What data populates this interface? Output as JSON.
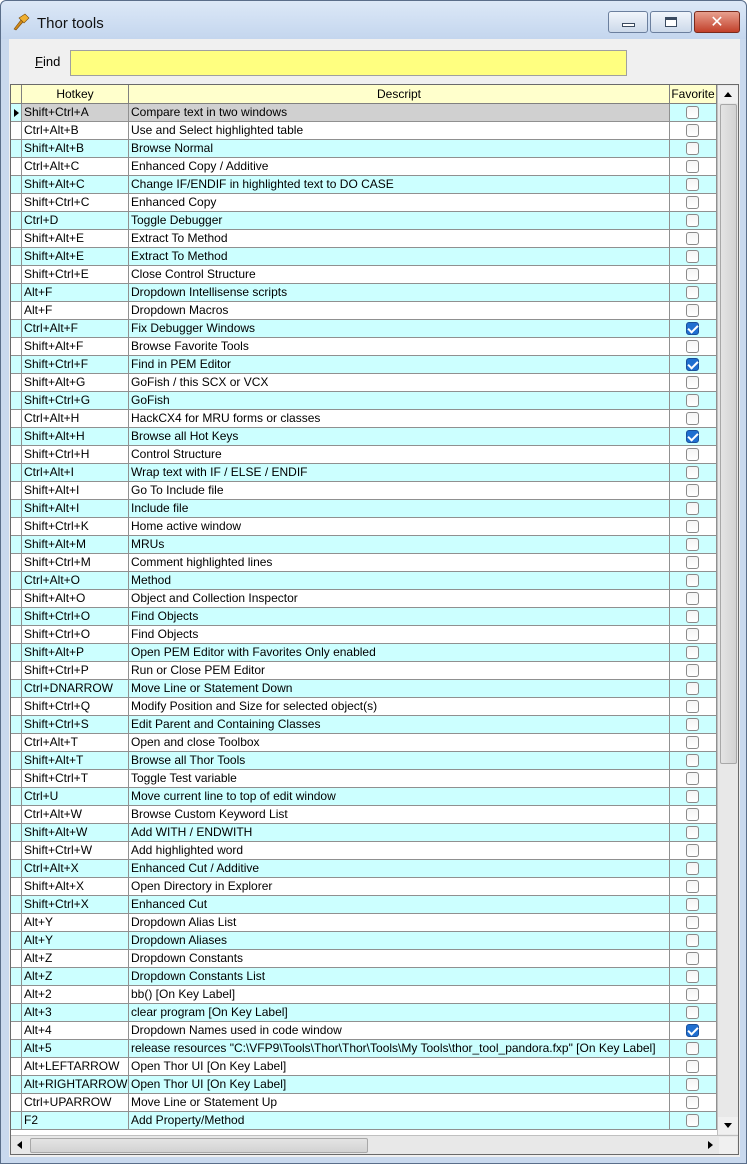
{
  "window": {
    "title": "Thor tools",
    "close_glyph": "✕"
  },
  "find": {
    "label": "Find",
    "label_accel": "F",
    "label_rest": "ind",
    "value": ""
  },
  "grid": {
    "columns": {
      "hotkey": "Hotkey",
      "descript": "Descript",
      "favorite": "Favorite"
    },
    "rows": [
      {
        "hotkey": "Shift+Ctrl+A",
        "descript": "Compare text in two windows",
        "favorite": false
      },
      {
        "hotkey": "Ctrl+Alt+B",
        "descript": "Use and Select highlighted table",
        "favorite": false
      },
      {
        "hotkey": "Shift+Alt+B",
        "descript": "Browse Normal",
        "favorite": false
      },
      {
        "hotkey": "Ctrl+Alt+C",
        "descript": "Enhanced Copy / Additive",
        "favorite": false
      },
      {
        "hotkey": "Shift+Alt+C",
        "descript": "Change IF/ENDIF in highlighted text to DO CASE",
        "favorite": false
      },
      {
        "hotkey": "Shift+Ctrl+C",
        "descript": "Enhanced Copy",
        "favorite": false
      },
      {
        "hotkey": "Ctrl+D",
        "descript": "Toggle Debugger",
        "favorite": false
      },
      {
        "hotkey": "Shift+Alt+E",
        "descript": "Extract To Method",
        "favorite": false
      },
      {
        "hotkey": "Shift+Alt+E",
        "descript": "Extract To Method",
        "favorite": false
      },
      {
        "hotkey": "Shift+Ctrl+E",
        "descript": "Close Control Structure",
        "favorite": false
      },
      {
        "hotkey": "Alt+F",
        "descript": "Dropdown Intellisense scripts",
        "favorite": false
      },
      {
        "hotkey": "Alt+F",
        "descript": "Dropdown Macros",
        "favorite": false
      },
      {
        "hotkey": "Ctrl+Alt+F",
        "descript": "Fix Debugger Windows",
        "favorite": true
      },
      {
        "hotkey": "Shift+Alt+F",
        "descript": "Browse Favorite Tools",
        "favorite": false
      },
      {
        "hotkey": "Shift+Ctrl+F",
        "descript": "Find in PEM Editor",
        "favorite": true
      },
      {
        "hotkey": "Shift+Alt+G",
        "descript": "GoFish / this SCX or VCX",
        "favorite": false
      },
      {
        "hotkey": "Shift+Ctrl+G",
        "descript": "GoFish",
        "favorite": false
      },
      {
        "hotkey": "Ctrl+Alt+H",
        "descript": "HackCX4 for MRU forms or classes",
        "favorite": false
      },
      {
        "hotkey": "Shift+Alt+H",
        "descript": "Browse all Hot Keys",
        "favorite": true
      },
      {
        "hotkey": "Shift+Ctrl+H",
        "descript": "Control Structure",
        "favorite": false
      },
      {
        "hotkey": "Ctrl+Alt+I",
        "descript": "Wrap text with IF / ELSE / ENDIF",
        "favorite": false
      },
      {
        "hotkey": "Shift+Alt+I",
        "descript": "Go To Include file",
        "favorite": false
      },
      {
        "hotkey": "Shift+Alt+I",
        "descript": "Include file",
        "favorite": false
      },
      {
        "hotkey": "Shift+Ctrl+K",
        "descript": "Home active window",
        "favorite": false
      },
      {
        "hotkey": "Shift+Alt+M",
        "descript": "MRUs",
        "favorite": false
      },
      {
        "hotkey": "Shift+Ctrl+M",
        "descript": "Comment highlighted lines",
        "favorite": false
      },
      {
        "hotkey": "Ctrl+Alt+O",
        "descript": "Method",
        "favorite": false
      },
      {
        "hotkey": "Shift+Alt+O",
        "descript": "Object and Collection Inspector",
        "favorite": false
      },
      {
        "hotkey": "Shift+Ctrl+O",
        "descript": "Find Objects",
        "favorite": false
      },
      {
        "hotkey": "Shift+Ctrl+O",
        "descript": "Find Objects",
        "favorite": false
      },
      {
        "hotkey": "Shift+Alt+P",
        "descript": "Open PEM Editor with Favorites Only enabled",
        "favorite": false
      },
      {
        "hotkey": "Shift+Ctrl+P",
        "descript": "Run or Close PEM Editor",
        "favorite": false
      },
      {
        "hotkey": "Ctrl+DNARROW",
        "descript": "Move Line or Statement Down",
        "favorite": false
      },
      {
        "hotkey": "Shift+Ctrl+Q",
        "descript": "Modify Position and Size for selected object(s)",
        "favorite": false
      },
      {
        "hotkey": "Shift+Ctrl+S",
        "descript": "Edit Parent and Containing Classes",
        "favorite": false
      },
      {
        "hotkey": "Ctrl+Alt+T",
        "descript": "Open and close Toolbox",
        "favorite": false
      },
      {
        "hotkey": "Shift+Alt+T",
        "descript": "Browse all Thor Tools",
        "favorite": false
      },
      {
        "hotkey": "Shift+Ctrl+T",
        "descript": "Toggle Test variable",
        "favorite": false
      },
      {
        "hotkey": "Ctrl+U",
        "descript": "Move current line to top of edit window",
        "favorite": false
      },
      {
        "hotkey": "Ctrl+Alt+W",
        "descript": "Browse Custom Keyword List",
        "favorite": false
      },
      {
        "hotkey": "Shift+Alt+W",
        "descript": "Add WITH / ENDWITH",
        "favorite": false
      },
      {
        "hotkey": "Shift+Ctrl+W",
        "descript": "Add highlighted word",
        "favorite": false
      },
      {
        "hotkey": "Ctrl+Alt+X",
        "descript": "Enhanced Cut / Additive",
        "favorite": false
      },
      {
        "hotkey": "Shift+Alt+X",
        "descript": "Open Directory in Explorer",
        "favorite": false
      },
      {
        "hotkey": "Shift+Ctrl+X",
        "descript": "Enhanced Cut",
        "favorite": false
      },
      {
        "hotkey": "Alt+Y",
        "descript": "Dropdown Alias List",
        "favorite": false
      },
      {
        "hotkey": "Alt+Y",
        "descript": "Dropdown Aliases",
        "favorite": false
      },
      {
        "hotkey": "Alt+Z",
        "descript": "Dropdown Constants",
        "favorite": false
      },
      {
        "hotkey": "Alt+Z",
        "descript": "Dropdown Constants List",
        "favorite": false
      },
      {
        "hotkey": "Alt+2",
        "descript": "bb() [On Key Label]",
        "favorite": false
      },
      {
        "hotkey": "Alt+3",
        "descript": "clear program [On Key Label]",
        "favorite": false
      },
      {
        "hotkey": "Alt+4",
        "descript": "Dropdown Names used in code window",
        "favorite": true
      },
      {
        "hotkey": "Alt+5",
        "descript": "release resources \"C:\\VFP9\\Tools\\Thor\\Thor\\Tools\\My Tools\\thor_tool_pandora.fxp\" [On Key Label]",
        "favorite": false
      },
      {
        "hotkey": "Alt+LEFTARROW",
        "descript": "Open Thor UI [On Key Label]",
        "favorite": false
      },
      {
        "hotkey": "Alt+RIGHTARROW",
        "descript": "Open Thor UI [On Key Label]",
        "favorite": false
      },
      {
        "hotkey": "Ctrl+UPARROW",
        "descript": "Move Line or Statement Up",
        "favorite": false
      },
      {
        "hotkey": "F2",
        "descript": "Add Property/Method",
        "favorite": false
      }
    ],
    "selected_index": 0
  },
  "colors": {
    "header_bg": "#ffffcc",
    "alt_row_bg": "#ccffff",
    "find_bg": "#ffff80",
    "checked": "#1f6fd0"
  }
}
